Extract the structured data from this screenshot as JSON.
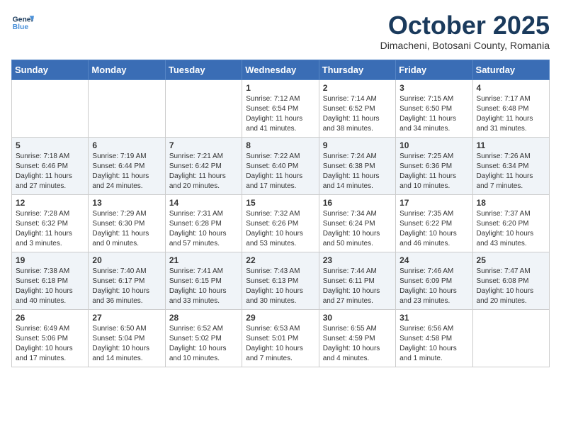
{
  "header": {
    "logo_line1": "General",
    "logo_line2": "Blue",
    "month": "October 2025",
    "location": "Dimacheni, Botosani County, Romania"
  },
  "weekdays": [
    "Sunday",
    "Monday",
    "Tuesday",
    "Wednesday",
    "Thursday",
    "Friday",
    "Saturday"
  ],
  "weeks": [
    [
      {
        "day": "",
        "info": ""
      },
      {
        "day": "",
        "info": ""
      },
      {
        "day": "",
        "info": ""
      },
      {
        "day": "1",
        "info": "Sunrise: 7:12 AM\nSunset: 6:54 PM\nDaylight: 11 hours and 41 minutes."
      },
      {
        "day": "2",
        "info": "Sunrise: 7:14 AM\nSunset: 6:52 PM\nDaylight: 11 hours and 38 minutes."
      },
      {
        "day": "3",
        "info": "Sunrise: 7:15 AM\nSunset: 6:50 PM\nDaylight: 11 hours and 34 minutes."
      },
      {
        "day": "4",
        "info": "Sunrise: 7:17 AM\nSunset: 6:48 PM\nDaylight: 11 hours and 31 minutes."
      }
    ],
    [
      {
        "day": "5",
        "info": "Sunrise: 7:18 AM\nSunset: 6:46 PM\nDaylight: 11 hours and 27 minutes."
      },
      {
        "day": "6",
        "info": "Sunrise: 7:19 AM\nSunset: 6:44 PM\nDaylight: 11 hours and 24 minutes."
      },
      {
        "day": "7",
        "info": "Sunrise: 7:21 AM\nSunset: 6:42 PM\nDaylight: 11 hours and 20 minutes."
      },
      {
        "day": "8",
        "info": "Sunrise: 7:22 AM\nSunset: 6:40 PM\nDaylight: 11 hours and 17 minutes."
      },
      {
        "day": "9",
        "info": "Sunrise: 7:24 AM\nSunset: 6:38 PM\nDaylight: 11 hours and 14 minutes."
      },
      {
        "day": "10",
        "info": "Sunrise: 7:25 AM\nSunset: 6:36 PM\nDaylight: 11 hours and 10 minutes."
      },
      {
        "day": "11",
        "info": "Sunrise: 7:26 AM\nSunset: 6:34 PM\nDaylight: 11 hours and 7 minutes."
      }
    ],
    [
      {
        "day": "12",
        "info": "Sunrise: 7:28 AM\nSunset: 6:32 PM\nDaylight: 11 hours and 3 minutes."
      },
      {
        "day": "13",
        "info": "Sunrise: 7:29 AM\nSunset: 6:30 PM\nDaylight: 11 hours and 0 minutes."
      },
      {
        "day": "14",
        "info": "Sunrise: 7:31 AM\nSunset: 6:28 PM\nDaylight: 10 hours and 57 minutes."
      },
      {
        "day": "15",
        "info": "Sunrise: 7:32 AM\nSunset: 6:26 PM\nDaylight: 10 hours and 53 minutes."
      },
      {
        "day": "16",
        "info": "Sunrise: 7:34 AM\nSunset: 6:24 PM\nDaylight: 10 hours and 50 minutes."
      },
      {
        "day": "17",
        "info": "Sunrise: 7:35 AM\nSunset: 6:22 PM\nDaylight: 10 hours and 46 minutes."
      },
      {
        "day": "18",
        "info": "Sunrise: 7:37 AM\nSunset: 6:20 PM\nDaylight: 10 hours and 43 minutes."
      }
    ],
    [
      {
        "day": "19",
        "info": "Sunrise: 7:38 AM\nSunset: 6:18 PM\nDaylight: 10 hours and 40 minutes."
      },
      {
        "day": "20",
        "info": "Sunrise: 7:40 AM\nSunset: 6:17 PM\nDaylight: 10 hours and 36 minutes."
      },
      {
        "day": "21",
        "info": "Sunrise: 7:41 AM\nSunset: 6:15 PM\nDaylight: 10 hours and 33 minutes."
      },
      {
        "day": "22",
        "info": "Sunrise: 7:43 AM\nSunset: 6:13 PM\nDaylight: 10 hours and 30 minutes."
      },
      {
        "day": "23",
        "info": "Sunrise: 7:44 AM\nSunset: 6:11 PM\nDaylight: 10 hours and 27 minutes."
      },
      {
        "day": "24",
        "info": "Sunrise: 7:46 AM\nSunset: 6:09 PM\nDaylight: 10 hours and 23 minutes."
      },
      {
        "day": "25",
        "info": "Sunrise: 7:47 AM\nSunset: 6:08 PM\nDaylight: 10 hours and 20 minutes."
      }
    ],
    [
      {
        "day": "26",
        "info": "Sunrise: 6:49 AM\nSunset: 5:06 PM\nDaylight: 10 hours and 17 minutes."
      },
      {
        "day": "27",
        "info": "Sunrise: 6:50 AM\nSunset: 5:04 PM\nDaylight: 10 hours and 14 minutes."
      },
      {
        "day": "28",
        "info": "Sunrise: 6:52 AM\nSunset: 5:02 PM\nDaylight: 10 hours and 10 minutes."
      },
      {
        "day": "29",
        "info": "Sunrise: 6:53 AM\nSunset: 5:01 PM\nDaylight: 10 hours and 7 minutes."
      },
      {
        "day": "30",
        "info": "Sunrise: 6:55 AM\nSunset: 4:59 PM\nDaylight: 10 hours and 4 minutes."
      },
      {
        "day": "31",
        "info": "Sunrise: 6:56 AM\nSunset: 4:58 PM\nDaylight: 10 hours and 1 minute."
      },
      {
        "day": "",
        "info": ""
      }
    ]
  ]
}
